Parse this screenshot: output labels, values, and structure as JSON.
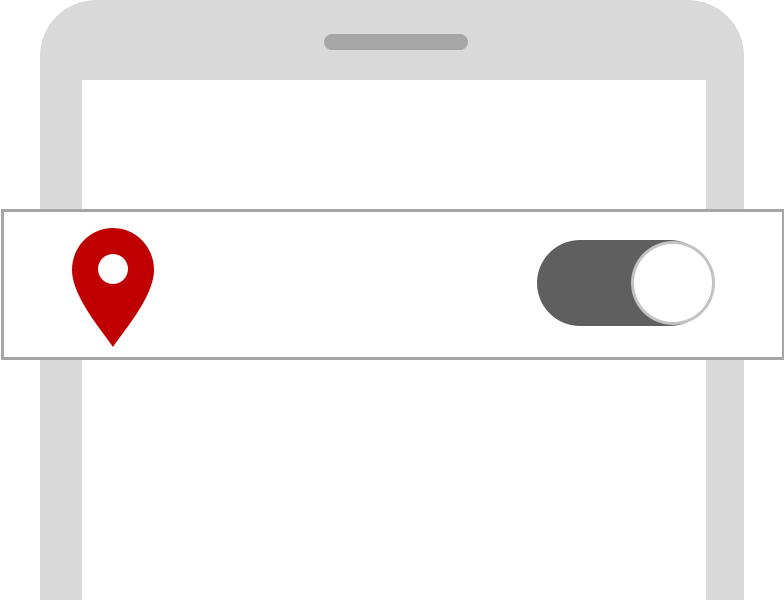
{
  "device": {
    "frame_color": "#d9d9d9",
    "speaker_color": "#a6a6a6"
  },
  "location_setting": {
    "icon": "location-pin-icon",
    "icon_color": "#c00000",
    "toggle": {
      "state": "on",
      "track_color": "#5f5f5f",
      "knob_color": "#ffffff"
    }
  }
}
